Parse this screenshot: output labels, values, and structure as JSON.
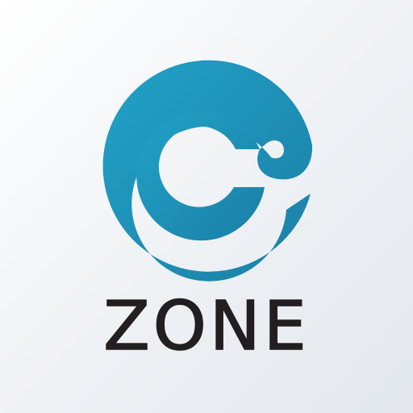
{
  "app": {
    "name": "ZONE",
    "icon": "swirl-at-logo-icon"
  },
  "colors": {
    "brand_blue": "#1f95bd",
    "brand_blue_dark": "#1a7fa6",
    "wordmark": "#231f20",
    "background": "#f1f3f5"
  }
}
